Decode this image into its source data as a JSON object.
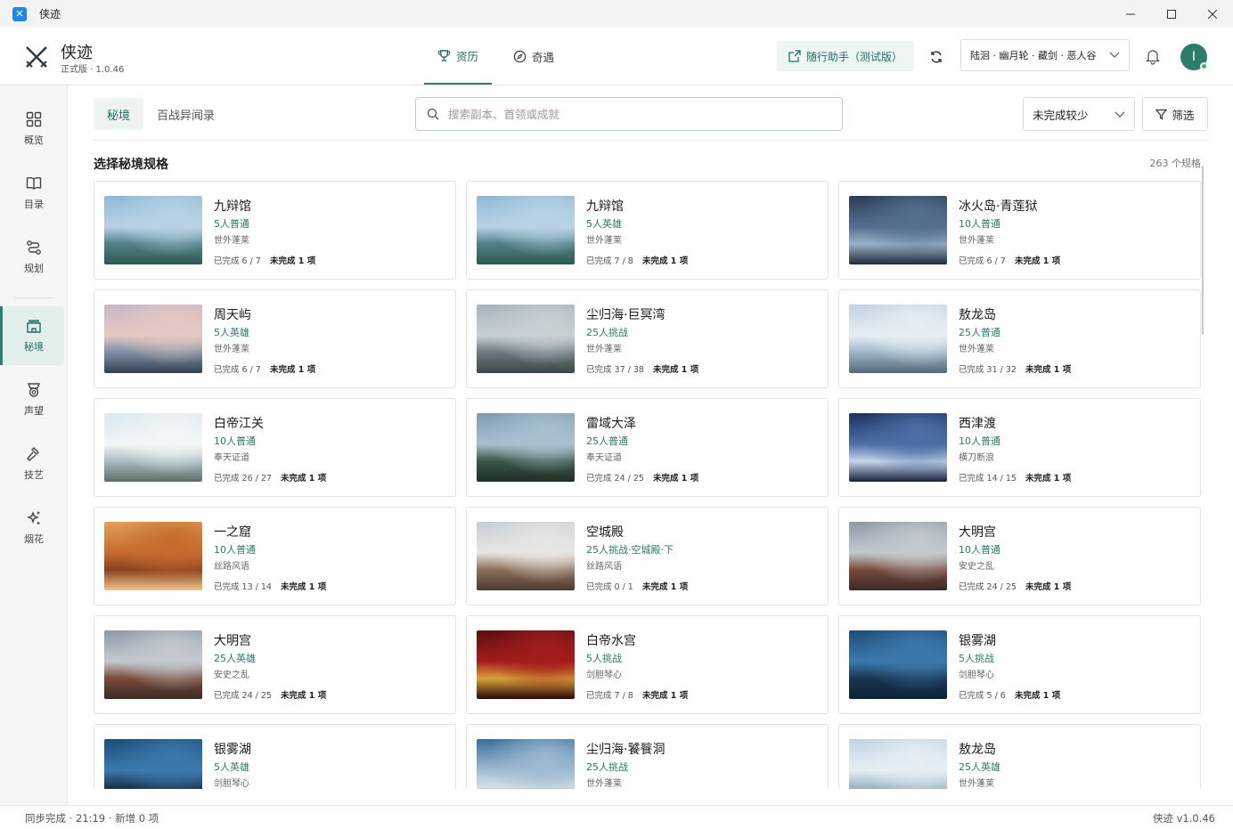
{
  "window": {
    "title": "侠迹",
    "app_icon": "app-icon-blue"
  },
  "header": {
    "brand_name": "侠迹",
    "brand_version": "正式版 · 1.0.46",
    "tabs": [
      {
        "label": "资历",
        "icon": "trophy-icon",
        "active": true
      },
      {
        "label": "奇遇",
        "icon": "compass-icon",
        "active": false
      }
    ],
    "assist_label": "随行助手（测试版）",
    "character": "陆洄 · 幽月轮 · 藏剑 · 恶人谷",
    "avatar_initial": "I"
  },
  "sidebar": {
    "items": [
      {
        "label": "概览",
        "icon": "grid-icon"
      },
      {
        "label": "目录",
        "icon": "book-icon"
      },
      {
        "label": "规划",
        "icon": "route-icon"
      },
      {
        "label": "秘境",
        "icon": "castle-icon",
        "active": true
      },
      {
        "label": "声望",
        "icon": "medal-icon"
      },
      {
        "label": "技艺",
        "icon": "hammer-icon"
      },
      {
        "label": "烟花",
        "icon": "firework-icon"
      }
    ]
  },
  "main": {
    "subtabs": [
      {
        "label": "秘境",
        "active": true
      },
      {
        "label": "百战异闻录",
        "active": false
      }
    ],
    "search_placeholder": "搜索副本、首领或成就",
    "sort_label": "未完成较少",
    "filter_label": "筛选",
    "section_title": "选择秘境规格",
    "count_label": "263 个规格"
  },
  "cards": [
    {
      "title": "九辩馆",
      "mode": "5人普通",
      "region": "世外蓬莱",
      "progress": "已完成 6 / 7",
      "incomplete": "未完成 1 项",
      "scene": "sea"
    },
    {
      "title": "九辩馆",
      "mode": "5人英雄",
      "region": "世外蓬莱",
      "progress": "已完成 7 / 8",
      "incomplete": "未完成 1 项",
      "scene": "sea"
    },
    {
      "title": "冰火岛·青莲狱",
      "mode": "10人普通",
      "region": "世外蓬莱",
      "progress": "已完成 6 / 7",
      "incomplete": "未完成 1 项",
      "scene": "cave"
    },
    {
      "title": "周天屿",
      "mode": "5人英雄",
      "region": "世外蓬莱",
      "progress": "已完成 6 / 7",
      "incomplete": "未完成 1 项",
      "scene": "dusk"
    },
    {
      "title": "尘归海·巨冥湾",
      "mode": "25人挑战",
      "region": "世外蓬莱",
      "progress": "已完成 37 / 38",
      "incomplete": "未完成 1 项",
      "scene": "mist"
    },
    {
      "title": "敖龙岛",
      "mode": "25人普通",
      "region": "世外蓬莱",
      "progress": "已完成 31 / 32",
      "incomplete": "未完成 1 项",
      "scene": "sky"
    },
    {
      "title": "白帝江关",
      "mode": "10人普通",
      "region": "奉天证道",
      "progress": "已完成 26 / 27",
      "incomplete": "未完成 1 项",
      "scene": "bright"
    },
    {
      "title": "雷域大泽",
      "mode": "25人普通",
      "region": "奉天证道",
      "progress": "已完成 24 / 25",
      "incomplete": "未完成 1 项",
      "scene": "forest"
    },
    {
      "title": "西津渡",
      "mode": "10人普通",
      "region": "横刀断浪",
      "progress": "已完成 14 / 15",
      "incomplete": "未完成 1 项",
      "scene": "night"
    },
    {
      "title": "一之窟",
      "mode": "10人普通",
      "region": "丝路风语",
      "progress": "已完成 13 / 14",
      "incomplete": "未完成 1 项",
      "scene": "canyon"
    },
    {
      "title": "空城殿",
      "mode": "25人挑战·空城殿·下",
      "region": "丝路风语",
      "progress": "已完成 0 / 1",
      "incomplete": "未完成 1 项",
      "scene": "palace"
    },
    {
      "title": "大明宫",
      "mode": "10人普通",
      "region": "安史之乱",
      "progress": "已完成 24 / 25",
      "incomplete": "未完成 1 项",
      "scene": "temple"
    },
    {
      "title": "大明宫",
      "mode": "25人英雄",
      "region": "安史之乱",
      "progress": "已完成 24 / 25",
      "incomplete": "未完成 1 项",
      "scene": "temple"
    },
    {
      "title": "白帝水宫",
      "mode": "5人挑战",
      "region": "剑胆琴心",
      "progress": "已完成 7 / 8",
      "incomplete": "未完成 1 项",
      "scene": "red"
    },
    {
      "title": "银雾湖",
      "mode": "5人挑战",
      "region": "剑胆琴心",
      "progress": "已完成 5 / 6",
      "incomplete": "未完成 1 项",
      "scene": "lake"
    },
    {
      "title": "银雾湖",
      "mode": "5人英雄",
      "region": "剑胆琴心",
      "progress": "",
      "incomplete": "",
      "scene": "lake"
    },
    {
      "title": "尘归海·饕餮洞",
      "mode": "25人挑战",
      "region": "世外蓬莱",
      "progress": "",
      "incomplete": "",
      "scene": "cloud"
    },
    {
      "title": "敖龙岛",
      "mode": "25人英雄",
      "region": "世外蓬莱",
      "progress": "",
      "incomplete": "",
      "scene": "sky"
    }
  ],
  "status": {
    "left": "同步完成 · 21:19 · 新增 0 项",
    "right": "侠迹 v1.0.46"
  },
  "colors": {
    "accent": "#2e7d70",
    "accent_text": "#1f6f64",
    "mode_text": "#2b7a68"
  }
}
